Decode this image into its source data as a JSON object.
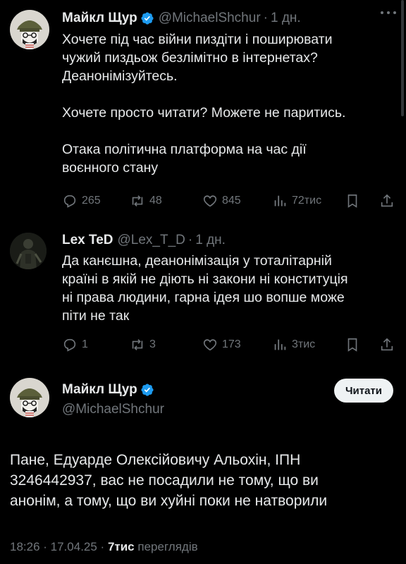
{
  "tweet1": {
    "name": "Майкл Щур",
    "handle": "@MichaelShchur",
    "time": "1 дн.",
    "text": "Хочете під час війни пиздіти і поширювати\nчужий пиздьож безлімітно в інтернетах?\nДеанонімізуйтесь.\n\nХочете просто читати? Можете не паритись.\n\nОтака політична платформа на час дії\nвоєнного стану",
    "replies": "265",
    "retweets": "48",
    "likes": "845",
    "views": "72тис"
  },
  "tweet2": {
    "name": "Lex TeD",
    "handle": "@Lex_T_D",
    "time": "1 дн.",
    "text": "Да канєшна, деанонімізація у тоталітарній\nкраїні в якій не діють ні закони ні конституція\nні права людини, гарна ідея шо вопше може\nпіти не так",
    "replies": "1",
    "retweets": "3",
    "likes": "173",
    "views": "3тис"
  },
  "tweet3": {
    "name": "Майкл Щур",
    "handle": "@MichaelShchur",
    "follow_label": "Читати",
    "text": "Пане, Едуарде Олексійовичу Альохін, ІПН\n3246442937, вас не посадили не тому, що ви\nанонім, а тому, що ви хуйні поки не натворили",
    "timestamp": "18:26 · 17.04.25 ·",
    "views_count": "7тис",
    "views_label": "переглядів"
  },
  "colors": {
    "background": "#000000",
    "text": "#e7e9ea",
    "muted": "#71767b",
    "verified": "#1d9bf0"
  }
}
